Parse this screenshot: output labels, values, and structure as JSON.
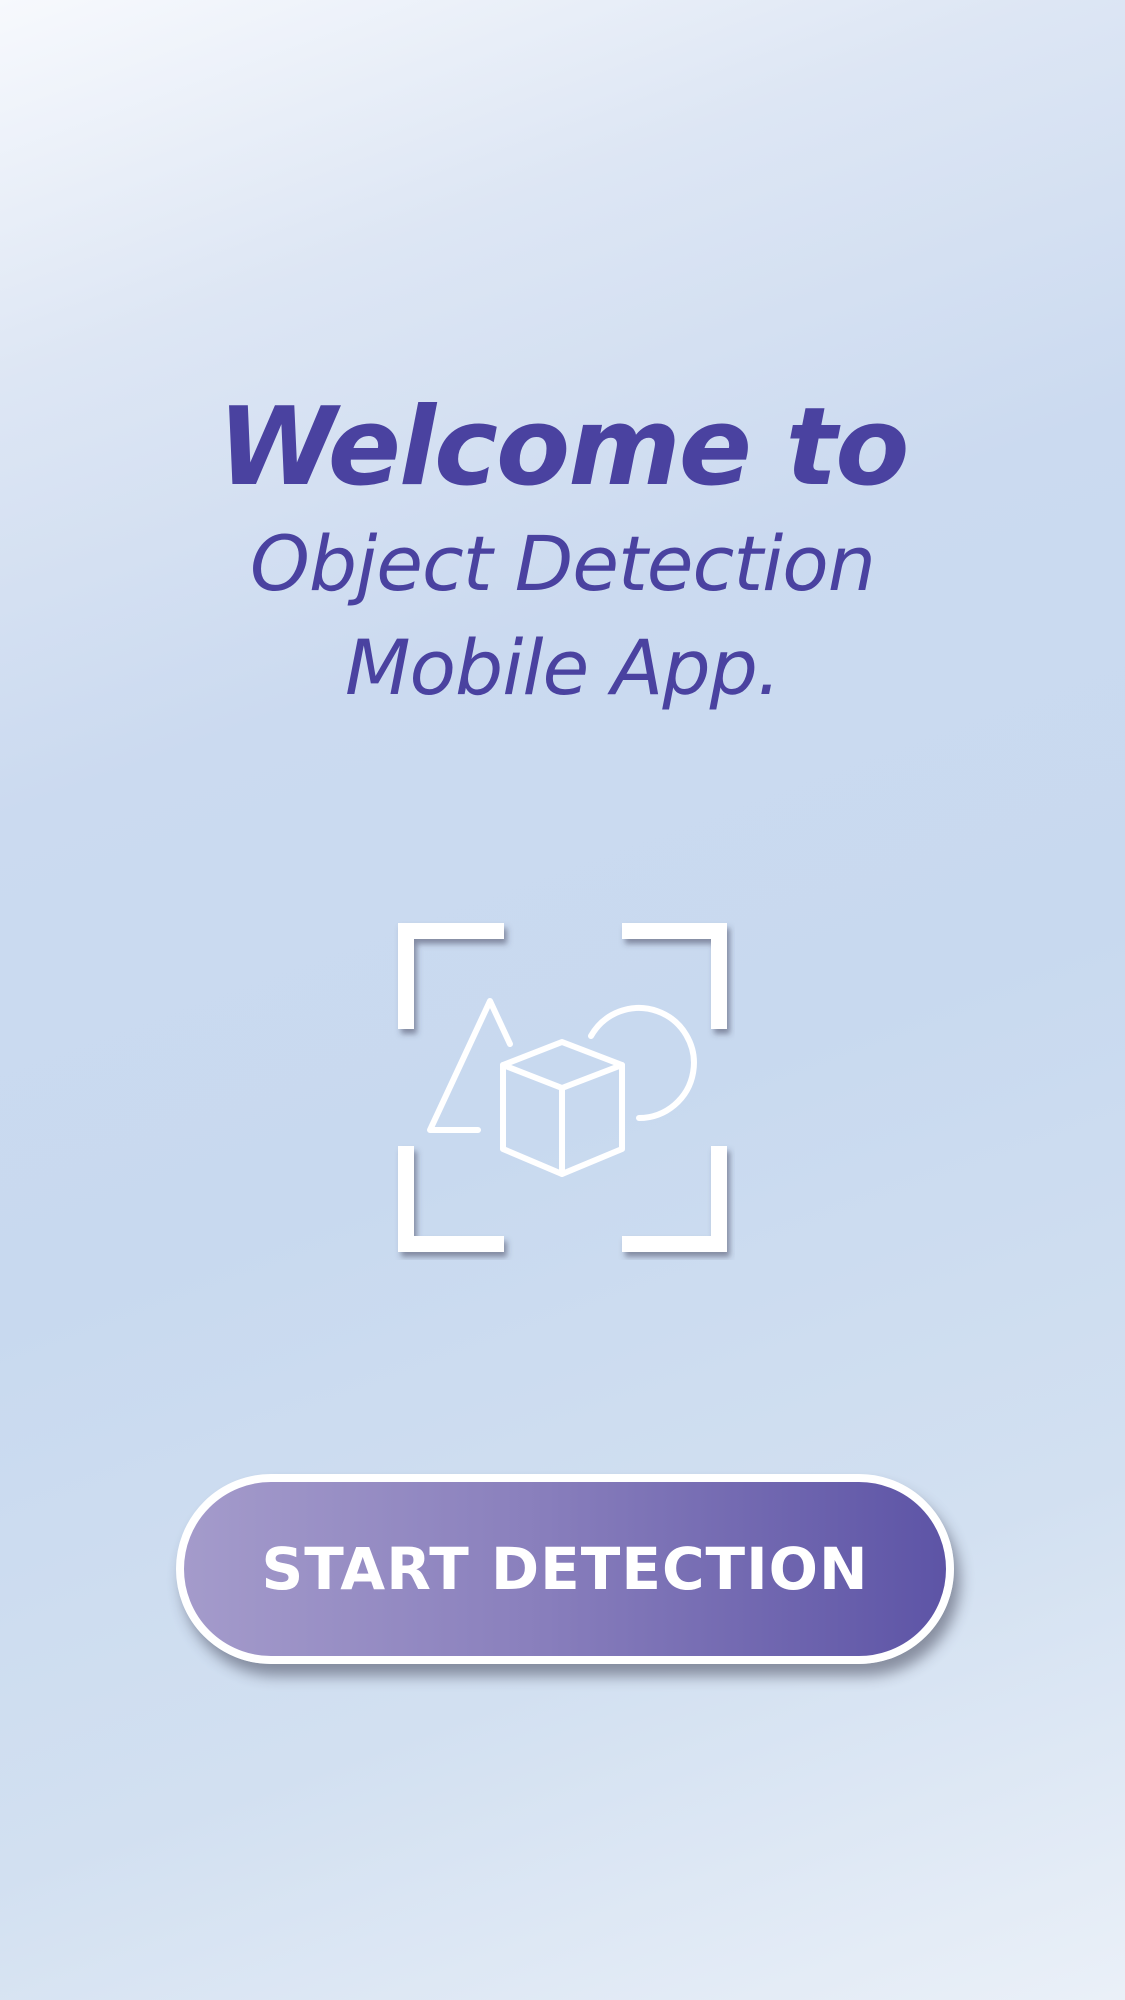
{
  "welcome": {
    "line1": "Welcome to",
    "line2": "Object Detection",
    "line3": "Mobile App."
  },
  "hero_icon": {
    "name": "object-detection-icon",
    "color": "#ffffff"
  },
  "start_button": {
    "label": "START DETECTION",
    "gradient_start": "#a49bcb",
    "gradient_end": "#5d54a6",
    "border_color": "#ffffff"
  },
  "colors": {
    "title": "#4a42a0",
    "background_light": "#f7f9fd",
    "background_mid": "#c8d9ef"
  }
}
